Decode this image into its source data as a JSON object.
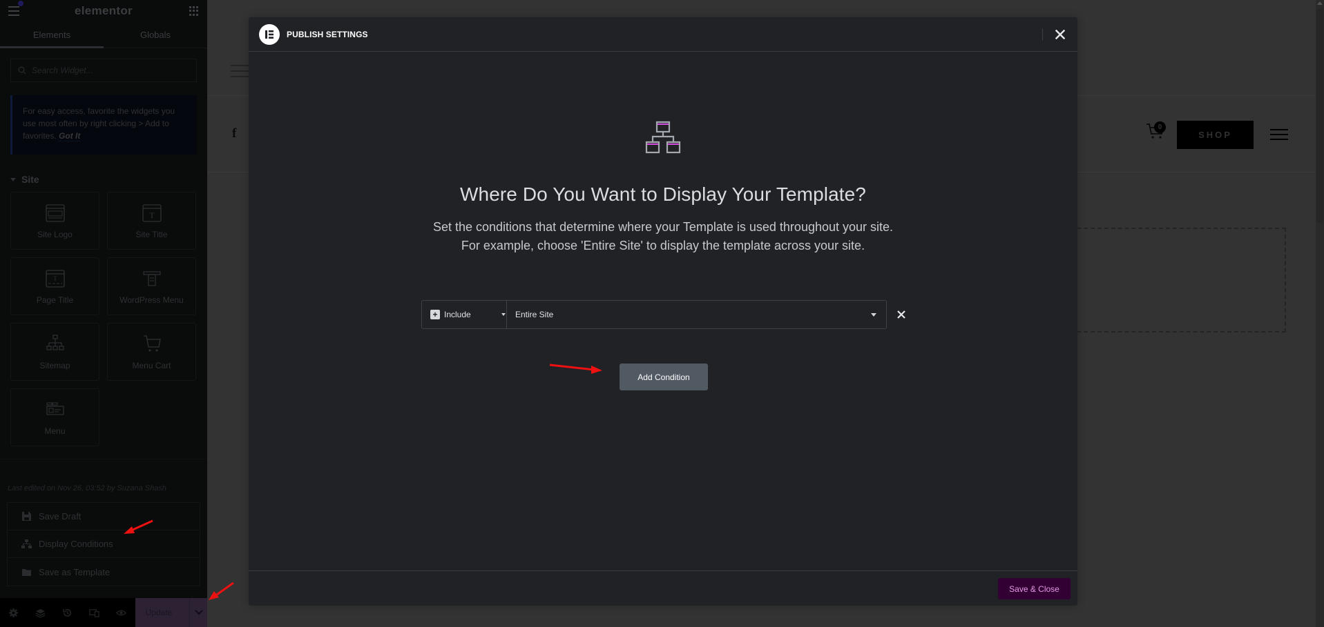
{
  "sidebar": {
    "logo": "elementor",
    "tabs": [
      {
        "label": "Elements",
        "active": true
      },
      {
        "label": "Globals",
        "active": false
      }
    ],
    "search": {
      "placeholder": "Search Widget...",
      "value": ""
    },
    "tip": {
      "text": "For easy access, favorite the widgets you use most often by right clicking > Add to favorites.",
      "link": "Got It"
    },
    "category": "Site",
    "widgets": [
      {
        "label": "Site Logo",
        "icon": "site-logo-icon"
      },
      {
        "label": "Site Title",
        "icon": "site-title-icon"
      },
      {
        "label": "Page Title",
        "icon": "page-title-icon"
      },
      {
        "label": "WordPress Menu",
        "icon": "wordpress-menu-icon"
      },
      {
        "label": "Sitemap",
        "icon": "sitemap-icon"
      },
      {
        "label": "Menu Cart",
        "icon": "cart-icon"
      },
      {
        "label": "Menu",
        "icon": "menu-widget-icon"
      }
    ],
    "last_edited": "Last edited on Nov 26, 03:52 by Suzana Shash",
    "save_menu": [
      {
        "label": "Save Draft",
        "icon": "floppy-icon"
      },
      {
        "label": "Display Conditions",
        "icon": "sitemap-icon"
      },
      {
        "label": "Save as Template",
        "icon": "folder-icon"
      }
    ],
    "bottom_tools": [
      "gear-icon",
      "layers-icon",
      "history-icon",
      "responsive-icon",
      "eye-icon"
    ],
    "update_label": "Update"
  },
  "page": {
    "cart_count": "0",
    "shop_label": "SHOP"
  },
  "modal": {
    "title": "PUBLISH SETTINGS",
    "heading": "Where Do You Want to Display Your Template?",
    "description_line1": "Set the conditions that determine where your Template is used throughout your site.",
    "description_line2": "For example, choose 'Entire Site' to display the template across your site.",
    "condition": {
      "type": "Include",
      "value": "Entire Site"
    },
    "add_condition_label": "Add Condition",
    "save_close_label": "Save & Close",
    "accent_color": "#330033",
    "accent_text_color": "#e59ae8"
  }
}
